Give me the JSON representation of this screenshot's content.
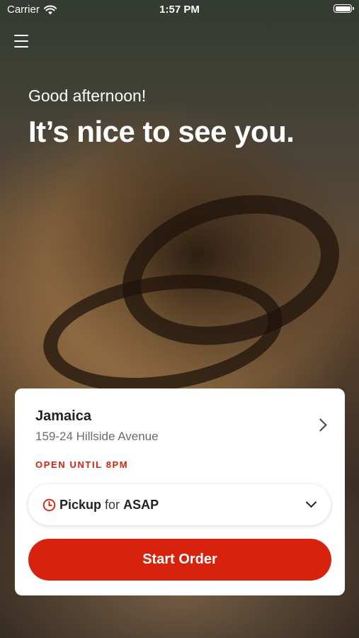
{
  "status_bar": {
    "carrier": "Carrier",
    "time": "1:57 PM",
    "icons": [
      "wifi-icon",
      "battery-icon"
    ]
  },
  "header": {
    "menu_icon": "hamburger-menu-icon",
    "greeting": "Good afternoon!",
    "headline": "It’s nice to see you."
  },
  "location_card": {
    "name": "Jamaica",
    "address": "159-24 Hillside Avenue",
    "open_status": "OPEN UNTIL 8PM",
    "order_type": "Pickup",
    "for_word": "for",
    "order_time": "ASAP",
    "start_order_label": "Start Order"
  },
  "colors": {
    "accent": "#d7230d",
    "card_background": "#ffffff",
    "status_text": "#d4230f"
  }
}
